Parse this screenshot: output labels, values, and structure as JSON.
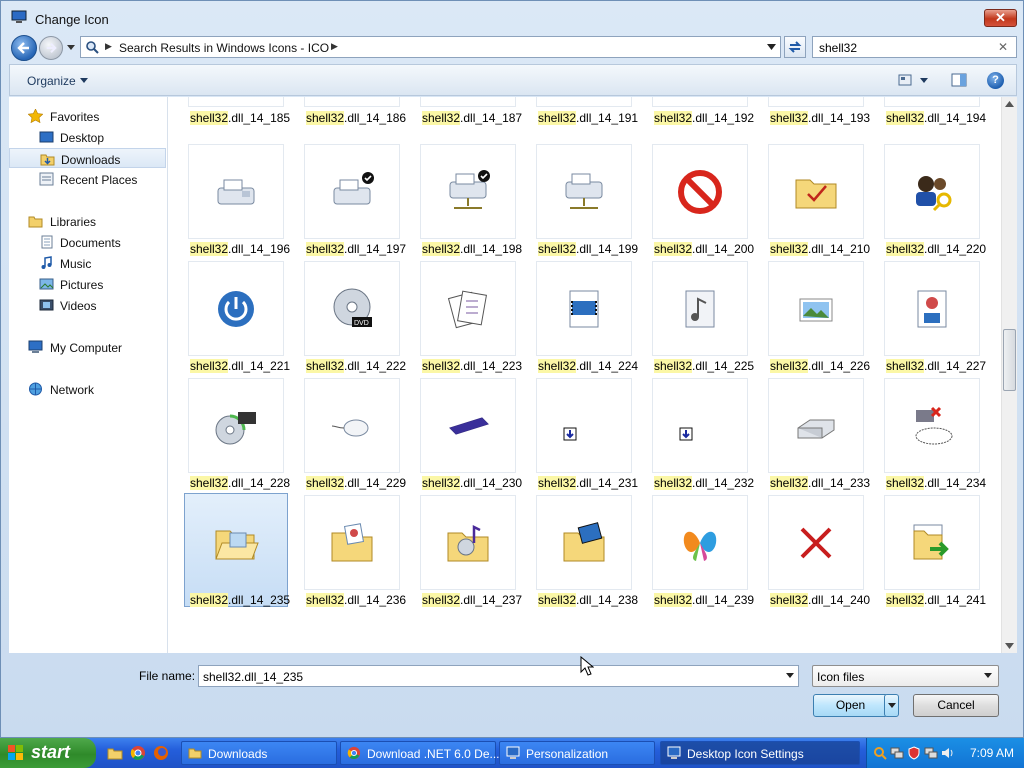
{
  "window": {
    "title": "Change Icon",
    "close_label": "✕"
  },
  "navigation": {
    "address_path": "Search Results in Windows Icons - ICO",
    "search_value": "shell32"
  },
  "toolbar": {
    "organize_label": "Organize"
  },
  "sidebar": {
    "favorites": {
      "label": "Favorites",
      "items": [
        {
          "label": "Desktop"
        },
        {
          "label": "Downloads"
        },
        {
          "label": "Recent Places"
        }
      ]
    },
    "libraries": {
      "label": "Libraries",
      "items": [
        {
          "label": "Documents"
        },
        {
          "label": "Music"
        },
        {
          "label": "Pictures"
        },
        {
          "label": "Videos"
        }
      ]
    },
    "computer": {
      "label": "My Computer"
    },
    "network": {
      "label": "Network"
    }
  },
  "grid": {
    "highlight": "shell32",
    "rows": [
      {
        "partial": true,
        "items": [
          ".dll_14_185",
          ".dll_14_186",
          ".dll_14_187",
          ".dll_14_191",
          ".dll_14_192",
          ".dll_14_193",
          ".dll_14_194"
        ]
      },
      {
        "items": [
          ".dll_14_196",
          ".dll_14_197",
          ".dll_14_198",
          ".dll_14_199",
          ".dll_14_200",
          ".dll_14_210",
          ".dll_14_220"
        ],
        "icons": [
          "fax",
          "fax-check",
          "fax-network-check",
          "fax-network",
          "no-entry",
          "folder-check",
          "users-key"
        ]
      },
      {
        "items": [
          ".dll_14_221",
          ".dll_14_222",
          ".dll_14_223",
          ".dll_14_224",
          ".dll_14_225",
          ".dll_14_226",
          ".dll_14_227"
        ],
        "icons": [
          "power",
          "dvd",
          "documents",
          "video-file",
          "music-file",
          "photos",
          "media-file"
        ]
      },
      {
        "items": [
          ".dll_14_228",
          ".dll_14_229",
          ".dll_14_230",
          ".dll_14_231",
          ".dll_14_232",
          ".dll_14_233",
          ".dll_14_234"
        ],
        "icons": [
          "cd-keyboard",
          "mouse",
          "scanner",
          "small-download",
          "small-download",
          "hard-drive",
          "network-disconnected"
        ]
      },
      {
        "items": [
          ".dll_14_235",
          ".dll_14_236",
          ".dll_14_237",
          ".dll_14_238",
          ".dll_14_239",
          ".dll_14_240",
          ".dll_14_241"
        ],
        "icons": [
          "folder-open",
          "folder-picture",
          "folder-music",
          "folder-video",
          "msn-butterfly",
          "red-x",
          "file-arrow"
        ]
      }
    ],
    "selected": ".dll_14_235"
  },
  "footer": {
    "filename_label": "File name:",
    "filename_value": "shell32.dll_14_235",
    "filter_value": "Icon files",
    "open_label": "Open",
    "cancel_label": "Cancel"
  },
  "taskbar": {
    "start_label": "start",
    "tasks": [
      {
        "label": "Downloads",
        "icon": "folder-icon"
      },
      {
        "label": "Download .NET 6.0 De...",
        "icon": "chrome-icon"
      },
      {
        "label": "Personalization",
        "icon": "monitor-icon"
      },
      {
        "label": "Desktop Icon Settings",
        "icon": "settings-icon"
      }
    ],
    "clock": "7:09 AM"
  },
  "colors": {
    "highlight": "#fbf7a6",
    "selection": "#c6ddf5",
    "taskbar": "#245edb",
    "start": "#2f8a2a"
  }
}
